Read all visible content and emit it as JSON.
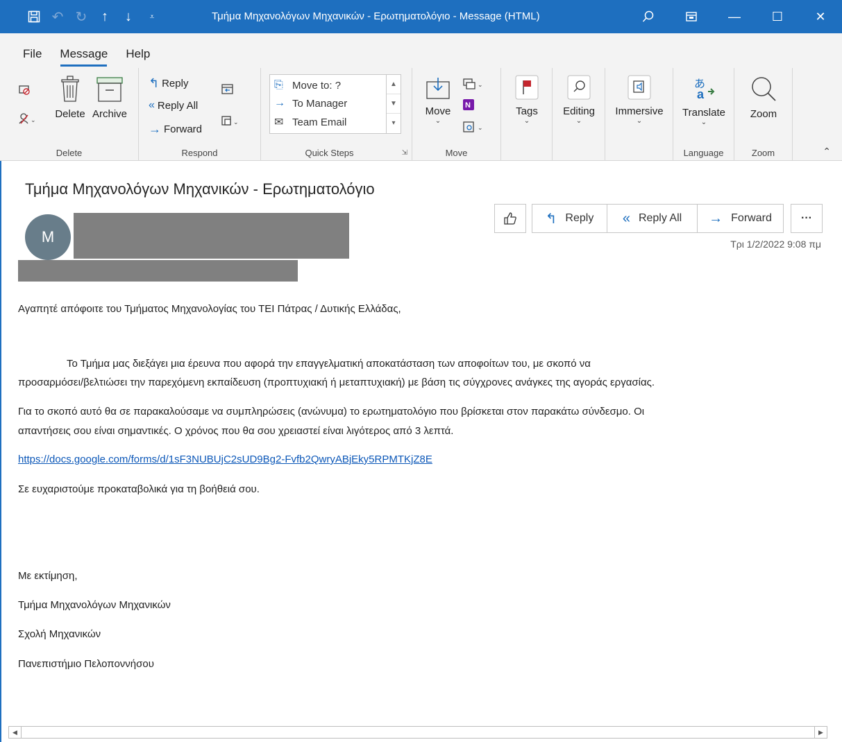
{
  "window": {
    "title": "Τμήμα Μηχανολόγων Μηχανικών - Ερωτηματολόγιο  -  Message (HTML)"
  },
  "ribbon_tabs": [
    {
      "label": "File"
    },
    {
      "label": "Message"
    },
    {
      "label": "Help"
    }
  ],
  "ribbon": {
    "delete_group": {
      "label": "Delete",
      "delete": "Delete",
      "archive": "Archive"
    },
    "respond_group": {
      "label": "Respond",
      "reply": "Reply",
      "reply_all": "Reply All",
      "forward": "Forward"
    },
    "quick_steps": {
      "label": "Quick Steps",
      "items": [
        "Move to: ?",
        "To Manager",
        "Team Email"
      ]
    },
    "move_group": {
      "label": "Move",
      "move": "Move"
    },
    "tags": "Tags",
    "editing": "Editing",
    "immersive": "Immersive",
    "language_group": {
      "label": "Language",
      "translate": "Translate"
    },
    "zoom_group": {
      "label": "Zoom",
      "zoom": "Zoom"
    }
  },
  "message": {
    "subject": "Τμήμα Μηχανολόγων Μηχανικών - Ερωτηματολόγιο",
    "avatar_initial": "M",
    "actions": {
      "reply": "Reply",
      "reply_all": "Reply All",
      "forward": "Forward",
      "more": "···"
    },
    "date": "Τρι 1/2/2022 9:08 πμ",
    "greeting": "Αγαπητέ απόφοιτε του Τμήματος Μηχανολογίας του ΤΕΙ Πάτρας / Δυτικής Ελλάδας,",
    "para1_line1": "Το Τμήμα μας διεξάγει μια έρευνα που αφορά την επαγγελματική αποκατάσταση των αποφοίτων του, με σκοπό να",
    "para1_line2": "προσαρμόσει/βελτιώσει την παρεχόμενη εκπαίδευση (προπτυχιακή ή μεταπτυχιακή) με βάση τις σύγχρονες ανάγκες της αγοράς εργασίας.",
    "para2_line1": "Για το σκοπό αυτό θα σε παρακαλούσαμε να συμπληρώσεις (ανώνυμα) το ερωτηματολόγιο που βρίσκεται στον παρακάτω σύνδεσμο. Οι",
    "para2_line2": "απαντήσεις σου είναι σημαντικές. Ο χρόνος που θα σου χρειαστεί είναι λιγότερος από 3 λεπτά.",
    "link": "https://docs.google.com/forms/d/1sF3NUBUjC2sUD9Bg2-Fvfb2QwryABjEky5RPMTKjZ8E",
    "thanks": "Σε ευχαριστούμε προκαταβολικά για τη βοήθειά σου.",
    "closing": "Με εκτίμηση,",
    "sig1": "Τμήμα Μηχανολόγων Μηχανικών",
    "sig2": "Σχολή Μηχανικών",
    "sig3": "Πανεπιστήμιο Πελοποννήσου"
  }
}
